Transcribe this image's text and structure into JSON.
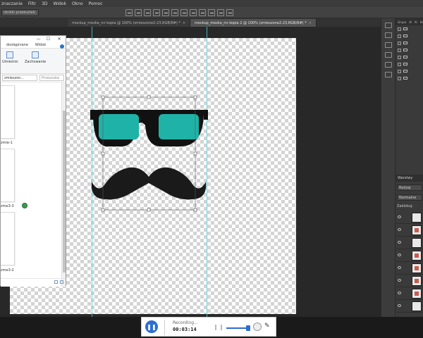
{
  "menubar": {
    "items": [
      "znaczanie",
      "Filtr",
      "3D",
      "Widok",
      "Okno",
      "Pomoc"
    ]
  },
  "options": {
    "label": "ntrolki przekształc."
  },
  "tabs": [
    {
      "label": "mockup_mezka_nn kopia @ 100% (zmieszone2-23,RGB/8#) *",
      "close": "×",
      "active": false
    },
    {
      "label": "mockup_mezka_nn kopia 2 @ 100% (zmieszone2-23,RGB/8#) *",
      "close": "×",
      "active": true
    }
  ],
  "explorer": {
    "tabs": [
      "dostępniane",
      "Widok"
    ],
    "ribbon": [
      "Umieśnic",
      "Zachowanie"
    ],
    "address": "zmieszon...",
    "search_placeholder": "Przeszuka",
    "files": [
      {
        "label": "zmie-1"
      },
      {
        "label": "zme3-3"
      },
      {
        "label": "zme3-2"
      }
    ]
  },
  "panels": {
    "tabs": [
      "Grupa",
      "Al",
      "Ki",
      "Ka"
    ],
    "layers_title": "Warstwy",
    "search": "Rodzaj",
    "blend_mode": "Normalne",
    "lock_label": "Zablokuj:"
  },
  "recorder": {
    "status": "Recording...",
    "time": "00:03:14",
    "pause_icon": "pause-icon"
  },
  "colors": {
    "lens": "#1fb3a8",
    "frame": "#111111",
    "guides": "#4fd4d4",
    "record_accent": "#2d6ed0"
  }
}
